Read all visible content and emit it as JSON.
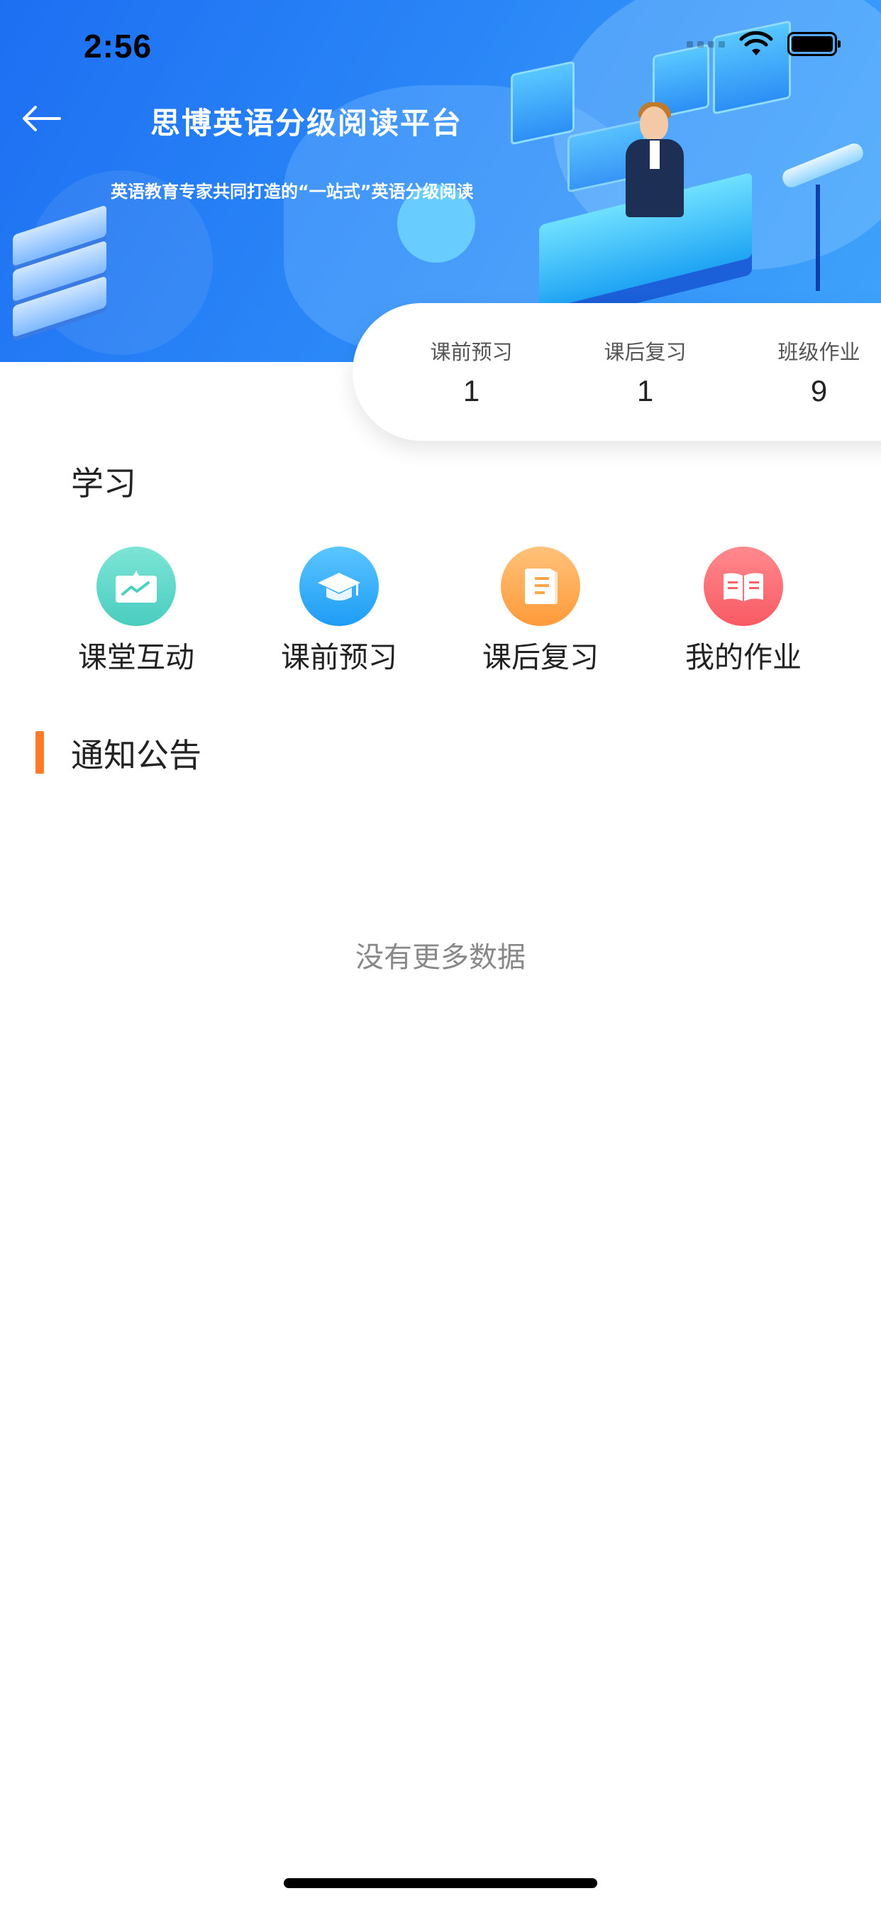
{
  "status_bar": {
    "time": "2:56"
  },
  "banner": {
    "title": "思博英语分级阅读平台",
    "subtitle": "英语教育专家共同打造的“一站式”英语分级阅读"
  },
  "stats": [
    {
      "label": "课前预习",
      "value": "1"
    },
    {
      "label": "课后复习",
      "value": "1"
    },
    {
      "label": "班级作业",
      "value": "9"
    }
  ],
  "learning": {
    "heading": "学习",
    "items": [
      {
        "label": "课堂互动",
        "icon": "presentation-board-icon",
        "color": "#4fd1c2"
      },
      {
        "label": "课前预习",
        "icon": "graduation-cap-icon",
        "color": "#28a6f7"
      },
      {
        "label": "课后复习",
        "icon": "document-icon",
        "color": "#ffa64a"
      },
      {
        "label": "我的作业",
        "icon": "open-book-icon",
        "color": "#fa6068"
      }
    ]
  },
  "notice": {
    "heading": "通知公告",
    "accent_color": "#ff7a2a",
    "empty_text": "没有更多数据"
  }
}
